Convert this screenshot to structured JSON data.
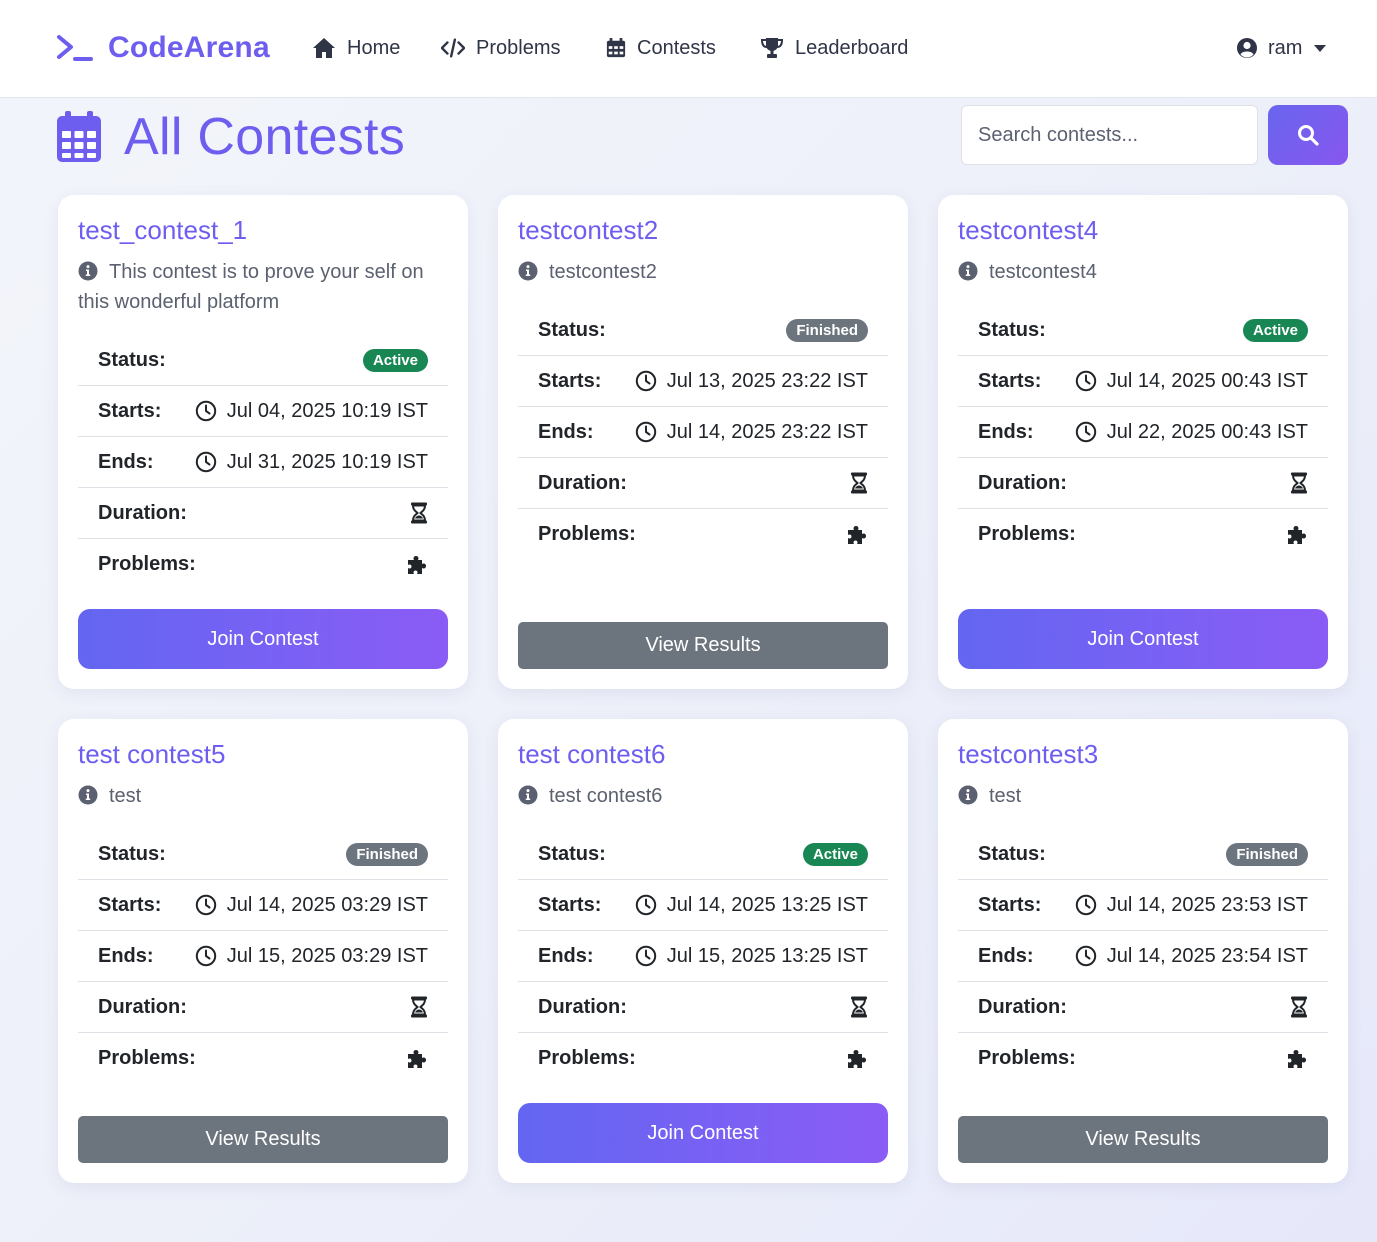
{
  "brand": {
    "name": "CodeArena",
    "icon": "terminal-icon"
  },
  "nav": {
    "items": [
      {
        "label": "Home",
        "icon": "home-icon"
      },
      {
        "label": "Problems",
        "icon": "code-icon"
      },
      {
        "label": "Contests",
        "icon": "calendar-icon"
      },
      {
        "label": "Leaderboard",
        "icon": "trophy-icon"
      }
    ],
    "user": {
      "name": "ram",
      "icon": "user-circle-icon"
    }
  },
  "page": {
    "title": "All Contests",
    "title_icon": "calendar-icon",
    "search": {
      "placeholder": "Search contests...",
      "value": ""
    }
  },
  "labels": {
    "status": "Status:",
    "starts": "Starts:",
    "ends": "Ends:",
    "duration": "Duration:",
    "problems": "Problems:"
  },
  "colors": {
    "accent": "#6e5ef0",
    "active": "#198754",
    "finished": "#6c757d",
    "join_gradient_start": "#6366f1",
    "join_gradient_end": "#8b5cf6"
  },
  "contests": [
    {
      "title": "test_contest_1",
      "description": "This contest is to prove your self on this wonderful platform",
      "status": "Active",
      "starts": "Jul 04, 2025 10:19 IST",
      "ends": "Jul 31, 2025 10:19 IST",
      "action": "Join Contest"
    },
    {
      "title": "testcontest2",
      "description": "testcontest2",
      "status": "Finished",
      "starts": "Jul 13, 2025 23:22 IST",
      "ends": "Jul 14, 2025 23:22 IST",
      "action": "View Results"
    },
    {
      "title": "testcontest4",
      "description": "testcontest4",
      "status": "Active",
      "starts": "Jul 14, 2025 00:43 IST",
      "ends": "Jul 22, 2025 00:43 IST",
      "action": "Join Contest"
    },
    {
      "title": "test contest5",
      "description": "test",
      "status": "Finished",
      "starts": "Jul 14, 2025 03:29 IST",
      "ends": "Jul 15, 2025 03:29 IST",
      "action": "View Results"
    },
    {
      "title": "test contest6",
      "description": "test contest6",
      "status": "Active",
      "starts": "Jul 14, 2025 13:25 IST",
      "ends": "Jul 15, 2025 13:25 IST",
      "action": "Join Contest"
    },
    {
      "title": "testcontest3",
      "description": "test",
      "status": "Finished",
      "starts": "Jul 14, 2025 23:53 IST",
      "ends": "Jul 14, 2025 23:54 IST",
      "action": "View Results"
    }
  ]
}
